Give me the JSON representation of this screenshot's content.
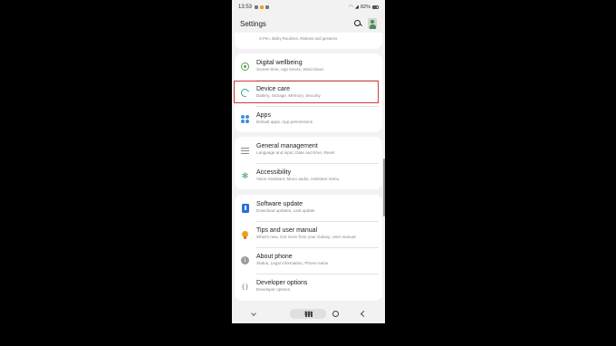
{
  "status_bar": {
    "time": "13:53",
    "battery": "82%"
  },
  "header": {
    "title": "Settings"
  },
  "partial_item": {
    "sub": "S Pen, Bixby Routines, Motions and gestures"
  },
  "groups": {
    "g1": [
      {
        "label": "Digital wellbeing",
        "sub": "Screen time, App timers, Wind down",
        "icon": "digital-wellbeing-icon"
      },
      {
        "label": "Device care",
        "sub": "Battery, Storage, Memory, Security",
        "icon": "device-care-icon",
        "highlighted": true
      },
      {
        "label": "Apps",
        "sub": "Default apps, App permissions",
        "icon": "apps-icon"
      }
    ],
    "g2": [
      {
        "label": "General management",
        "sub": "Language and input, Date and time, Reset",
        "icon": "sliders-icon"
      },
      {
        "label": "Accessibility",
        "sub": "Voice Assistant, Mono audio, Assistant menu",
        "icon": "accessibility-icon"
      }
    ],
    "g3": [
      {
        "label": "Software update",
        "sub": "Download updates, Last update",
        "icon": "software-update-icon"
      },
      {
        "label": "Tips and user manual",
        "sub": "What's new, Get more from your Galaxy, User manual",
        "icon": "lightbulb-icon"
      },
      {
        "label": "About phone",
        "sub": "Status, Legal information, Phone name",
        "icon": "info-icon"
      },
      {
        "label": "Developer options",
        "sub": "Developer options",
        "icon": "developer-icon"
      }
    ]
  },
  "colors": {
    "highlight": "#d23b3b",
    "background": "#000000",
    "panel": "#f2f2f2"
  }
}
